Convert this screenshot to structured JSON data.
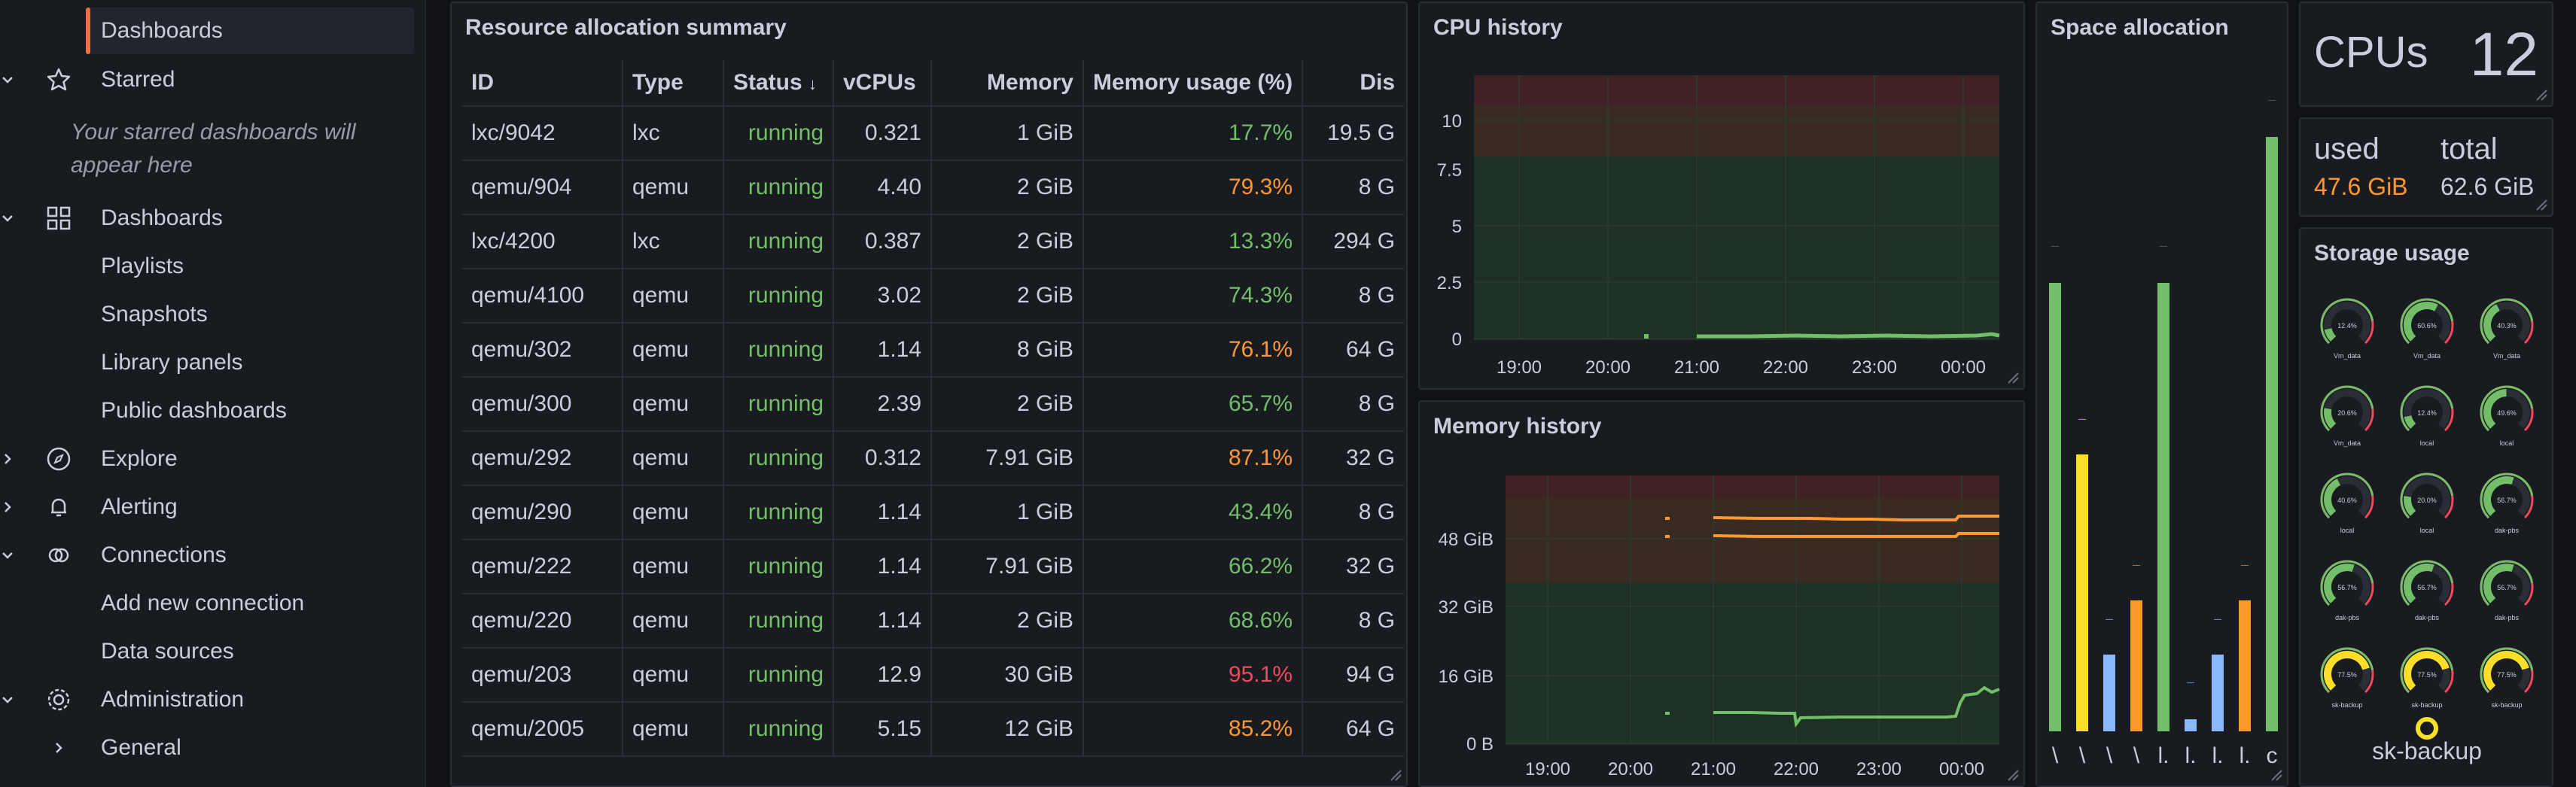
{
  "sidebar": {
    "items": [
      {
        "label": "Dashboards",
        "active": true
      },
      {
        "label": "Starred"
      },
      {
        "label": "Dashboards"
      },
      {
        "label": "Playlists"
      },
      {
        "label": "Snapshots"
      },
      {
        "label": "Library panels"
      },
      {
        "label": "Public dashboards"
      },
      {
        "label": "Explore"
      },
      {
        "label": "Alerting"
      },
      {
        "label": "Connections"
      },
      {
        "label": "Add new connection"
      },
      {
        "label": "Data sources"
      },
      {
        "label": "Administration"
      },
      {
        "label": "General"
      }
    ],
    "starred_empty_line1": "Your starred dashboards will",
    "starred_empty_line2": "appear here"
  },
  "resource_table": {
    "title": "Resource allocation summary",
    "columns": [
      "ID",
      "Type",
      "Status",
      "vCPUs",
      "Memory",
      "Memory usage (%)",
      "Dis"
    ],
    "rows": [
      {
        "id": "lxc/9042",
        "type": "lxc",
        "status": "running",
        "vcpus": "0.321",
        "memory": "1 GiB",
        "usage": "17.7%",
        "usage_color": "green",
        "disk": "19.5 G"
      },
      {
        "id": "qemu/904",
        "type": "qemu",
        "status": "running",
        "vcpus": "4.40",
        "memory": "2 GiB",
        "usage": "79.3%",
        "usage_color": "orange",
        "disk": "8 G"
      },
      {
        "id": "lxc/4200",
        "type": "lxc",
        "status": "running",
        "vcpus": "0.387",
        "memory": "2 GiB",
        "usage": "13.3%",
        "usage_color": "green",
        "disk": "294 G"
      },
      {
        "id": "qemu/4100",
        "type": "qemu",
        "status": "running",
        "vcpus": "3.02",
        "memory": "2 GiB",
        "usage": "74.3%",
        "usage_color": "green",
        "disk": "8 G"
      },
      {
        "id": "qemu/302",
        "type": "qemu",
        "status": "running",
        "vcpus": "1.14",
        "memory": "8 GiB",
        "usage": "76.1%",
        "usage_color": "orange",
        "disk": "64 G"
      },
      {
        "id": "qemu/300",
        "type": "qemu",
        "status": "running",
        "vcpus": "2.39",
        "memory": "2 GiB",
        "usage": "65.7%",
        "usage_color": "green",
        "disk": "8 G"
      },
      {
        "id": "qemu/292",
        "type": "qemu",
        "status": "running",
        "vcpus": "0.312",
        "memory": "7.91 GiB",
        "usage": "87.1%",
        "usage_color": "orange",
        "disk": "32 G"
      },
      {
        "id": "qemu/290",
        "type": "qemu",
        "status": "running",
        "vcpus": "1.14",
        "memory": "1 GiB",
        "usage": "43.4%",
        "usage_color": "green",
        "disk": "8 G"
      },
      {
        "id": "qemu/222",
        "type": "qemu",
        "status": "running",
        "vcpus": "1.14",
        "memory": "7.91 GiB",
        "usage": "66.2%",
        "usage_color": "green",
        "disk": "32 G"
      },
      {
        "id": "qemu/220",
        "type": "qemu",
        "status": "running",
        "vcpus": "1.14",
        "memory": "2 GiB",
        "usage": "68.6%",
        "usage_color": "green",
        "disk": "8 G"
      },
      {
        "id": "qemu/203",
        "type": "qemu",
        "status": "running",
        "vcpus": "12.9",
        "memory": "30 GiB",
        "usage": "95.1%",
        "usage_color": "red",
        "disk": "94 G"
      },
      {
        "id": "qemu/2005",
        "type": "qemu",
        "status": "running",
        "vcpus": "5.15",
        "memory": "12 GiB",
        "usage": "85.2%",
        "usage_color": "orange",
        "disk": "64 G"
      }
    ]
  },
  "cpu_history": {
    "title": "CPU history",
    "y_ticks": [
      "10",
      "7.5",
      "5",
      "2.5",
      "0"
    ],
    "x_ticks": [
      "19:00",
      "20:00",
      "21:00",
      "22:00",
      "23:00",
      "00:00"
    ]
  },
  "memory_history": {
    "title": "Memory history",
    "y_ticks": [
      "48 GiB",
      "32 GiB",
      "16 GiB",
      "0 B"
    ],
    "x_ticks": [
      "19:00",
      "20:00",
      "21:00",
      "22:00",
      "23:00",
      "00:00"
    ]
  },
  "space_allocation": {
    "title": "Space allocation",
    "bar_labels": [
      "\\",
      "\\",
      "\\",
      "\\",
      "l.",
      "l.",
      "l.",
      "l.",
      "c"
    ]
  },
  "cpus_stat": {
    "label": "CPUs",
    "value": "12"
  },
  "memory_stat": {
    "used_label": "used",
    "used_value": "47.6 GiB",
    "total_label": "total",
    "total_value": "62.6 GiB"
  },
  "storage_usage": {
    "title": "Storage usage",
    "gauges": [
      {
        "label": "Vm_data",
        "value": "12.4%"
      },
      {
        "label": "Vm_data",
        "value": "60.6%"
      },
      {
        "label": "Vm_data",
        "value": "40.3%"
      },
      {
        "label": "Vm_data",
        "value": "20.6%"
      },
      {
        "label": "local",
        "value": "12.4%"
      },
      {
        "label": "local",
        "value": "49.6%"
      },
      {
        "label": "local",
        "value": "40.6%"
      },
      {
        "label": "local",
        "value": "20.0%"
      },
      {
        "label": "dak-pbs",
        "value": "56.7%"
      },
      {
        "label": "dak-pbs",
        "value": "56.7%"
      },
      {
        "label": "dak-pbs",
        "value": "56.7%"
      },
      {
        "label": "dak-pbs",
        "value": "56.7%"
      },
      {
        "label": "sk-backup",
        "value": "77.5%"
      },
      {
        "label": "sk-backup",
        "value": "77.5%"
      },
      {
        "label": "sk-backup",
        "value": "77.5%"
      }
    ],
    "footer_label": "sk-backup"
  },
  "colors": {
    "accent": "#f2703f",
    "green": "#73bf69",
    "orange": "#ff9830",
    "red": "#f2495c",
    "yellow": "#fade2a",
    "blue": "#8ab8ff"
  }
}
